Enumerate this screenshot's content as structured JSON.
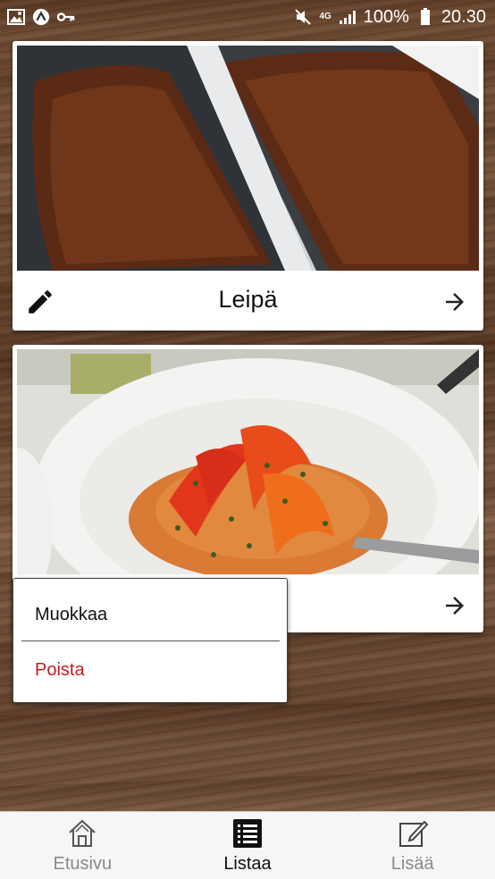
{
  "status_bar": {
    "battery": "100%",
    "time": "20.30",
    "network": "4G"
  },
  "recipes": [
    {
      "title": "Leipä",
      "image": "bread-loaves-photo"
    },
    {
      "title": "",
      "image": "pasta-with-peppers-photo"
    }
  ],
  "context_menu": {
    "edit_label": "Muokkaa",
    "delete_label": "Poista"
  },
  "bottom_nav": {
    "items": [
      {
        "label": "Etusivu",
        "icon": "home-icon",
        "active": false
      },
      {
        "label": "Listaa",
        "icon": "list-icon",
        "active": true
      },
      {
        "label": "Lisää",
        "icon": "add-note-icon",
        "active": false
      }
    ]
  },
  "colors": {
    "delete_text": "#c21f1f",
    "nav_inactive": "#8a8a8a",
    "nav_active": "#111111"
  }
}
